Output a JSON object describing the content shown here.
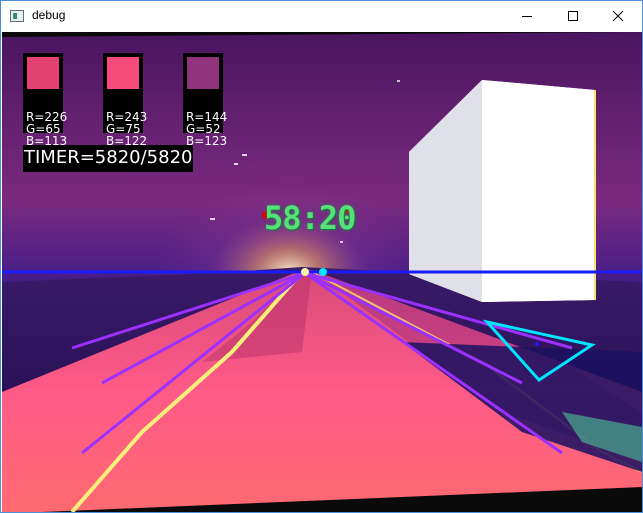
{
  "window": {
    "title": "debug",
    "controls": {
      "minimize": "minimize",
      "maximize": "maximize",
      "close": "close"
    }
  },
  "swatches": [
    {
      "color": "#e24171",
      "r": "R=226",
      "g": "G=65",
      "b": "B=113"
    },
    {
      "color": "#f34b7a",
      "r": "R=243",
      "g": "G=75",
      "b": "B=122"
    },
    {
      "color": "#90347b",
      "r": "R=144",
      "g": "G=52",
      "b": "B=123"
    }
  ],
  "timer": {
    "text": "TIMER=5820/5820"
  },
  "clock": {
    "text": "58:20"
  },
  "colors": {
    "horizon_line": "#1a1aff",
    "guide_lines": "#9b30ff",
    "marker_cyan": "#00e5ff",
    "marker_red": "#e00000",
    "road": "#ff4f82",
    "sky_top": "#5a1a7a",
    "ground_dark": "#1a0a50"
  }
}
